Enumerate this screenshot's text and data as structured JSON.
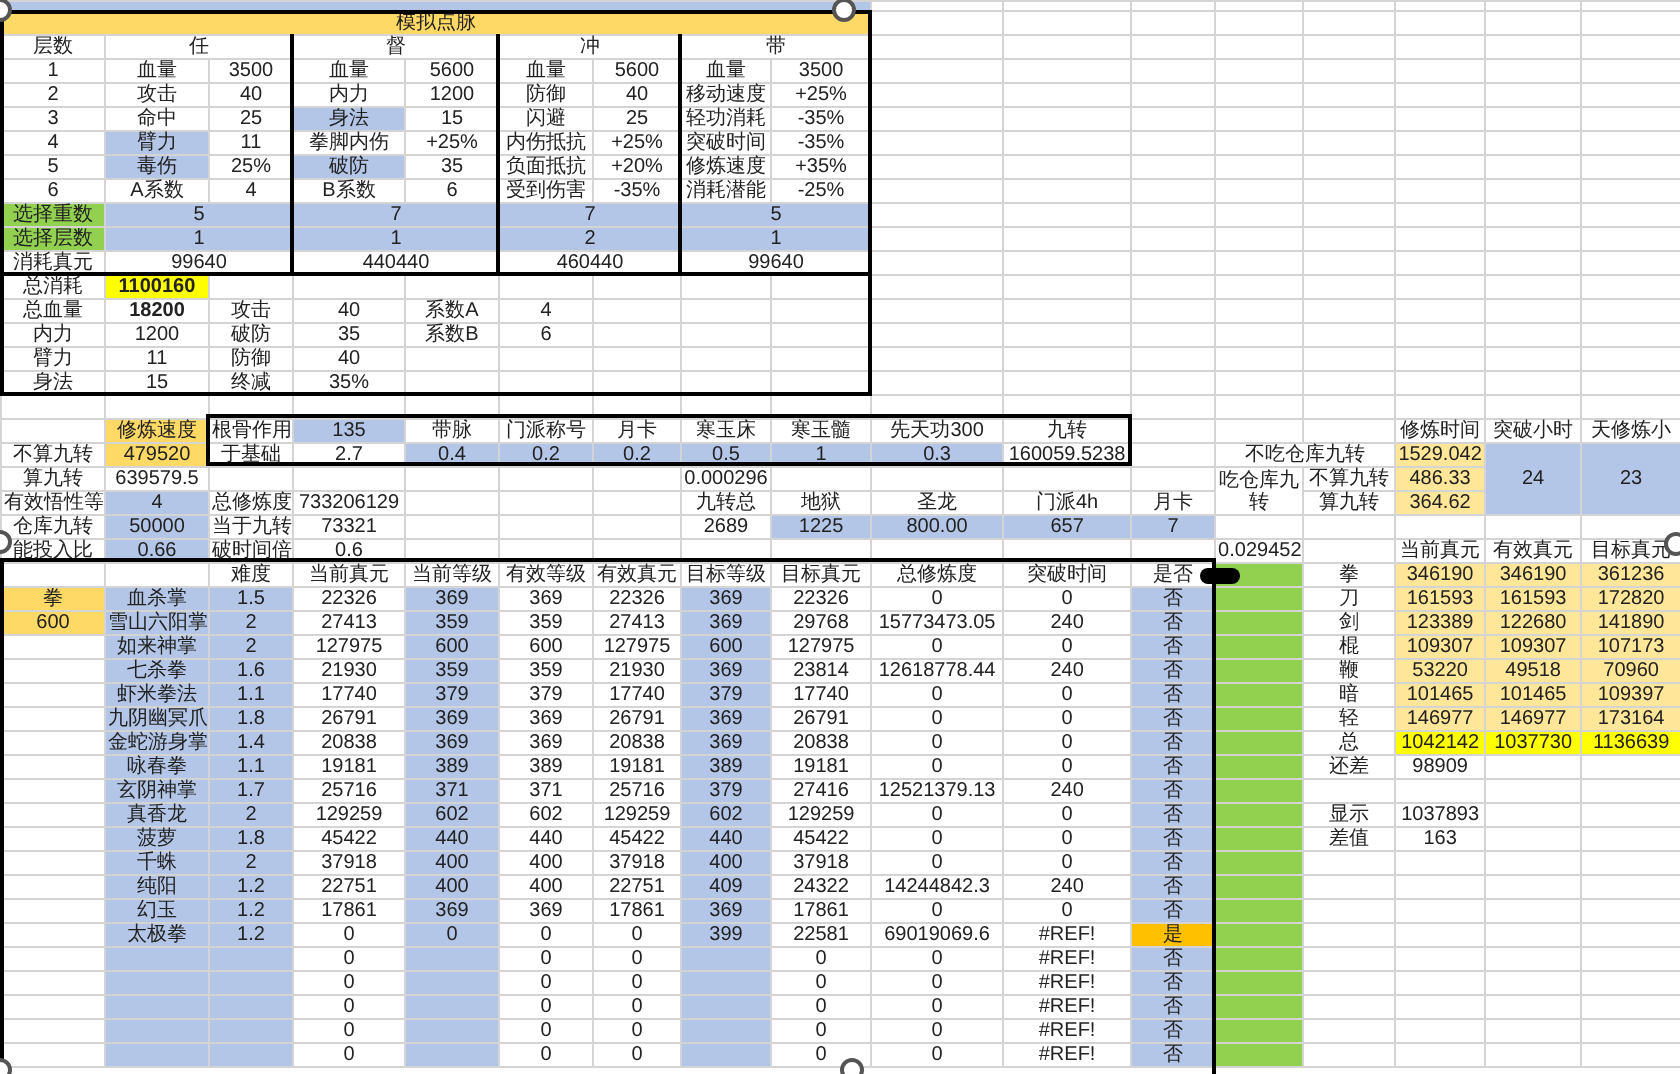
{
  "sheet": {
    "rows": [
      [
        {
          "color": "#b4c6e7",
          "colspan": 9
        }
      ],
      [
        {
          "text": "模拟点脉",
          "color": "#ffd966",
          "colspan": 9
        }
      ],
      [
        "层数",
        {
          "text": "任",
          "colspan": 2
        },
        {
          "text": "督",
          "colspan": 2
        },
        {
          "text": "冲",
          "colspan": 2
        },
        {
          "text": "带",
          "colspan": 2
        }
      ],
      [
        "1",
        "血量",
        "3500",
        "血量",
        "5600",
        "血量",
        "5600",
        "血量",
        "3500"
      ],
      [
        "2",
        "攻击",
        "40",
        "内力",
        "1200",
        "防御",
        "40",
        "移动速度",
        "+25%"
      ],
      [
        "3",
        "命中",
        "25",
        {
          "text": "身法",
          "color": "#b4c6e7"
        },
        "15",
        "闪避",
        "25",
        "轻功消耗",
        "-35%"
      ],
      [
        "4",
        {
          "text": "臂力",
          "color": "#b4c6e7"
        },
        "11",
        "拳脚内伤",
        "+25%",
        "内伤抵抗",
        "+25%",
        "突破时间",
        "-35%"
      ],
      [
        "5",
        {
          "text": "毒伤",
          "color": "#b4c6e7"
        },
        "25%",
        {
          "text": "破防",
          "color": "#b4c6e7"
        },
        "35",
        "负面抵抗",
        "+20%",
        "修炼速度",
        "+35%"
      ],
      [
        "6",
        "A系数",
        "4",
        "B系数",
        "6",
        "受到伤害",
        "-35%",
        "消耗潜能",
        "-25%"
      ],
      [
        {
          "text": "选择重数",
          "color": "#92d050"
        },
        {
          "text": "5",
          "color": "#b4c6e7",
          "colspan": 2
        },
        {
          "text": "7",
          "color": "#b4c6e7",
          "colspan": 2
        },
        {
          "text": "7",
          "color": "#b4c6e7",
          "colspan": 2
        },
        {
          "text": "5",
          "color": "#b4c6e7",
          "colspan": 2
        }
      ],
      [
        {
          "text": "选择层数",
          "color": "#92d050"
        },
        {
          "text": "1",
          "color": "#b4c6e7",
          "colspan": 2
        },
        {
          "text": "1",
          "color": "#b4c6e7",
          "colspan": 2
        },
        {
          "text": "2",
          "color": "#b4c6e7",
          "colspan": 2
        },
        {
          "text": "1",
          "color": "#b4c6e7",
          "colspan": 2
        }
      ],
      [
        "消耗真元",
        {
          "text": "99640",
          "colspan": 2
        },
        {
          "text": "440440",
          "colspan": 2
        },
        {
          "text": "460440",
          "colspan": 2
        },
        {
          "text": "99640",
          "colspan": 2
        }
      ],
      [
        "总消耗",
        {
          "text": "1100160",
          "color": "#ffff00",
          "bold": true
        }
      ],
      [
        "总血量",
        {
          "text": "18200",
          "bold": true
        },
        "攻击",
        "40",
        "系数A",
        "4"
      ],
      [
        "内力",
        "1200",
        "破防",
        "35",
        "系数B",
        "6"
      ],
      [
        "臂力",
        "11",
        "防御",
        "40"
      ],
      [
        "身法",
        "15",
        "终减",
        "35%"
      ],
      [],
      [
        null,
        {
          "text": "修炼速度",
          "color": "#ffd966"
        },
        "根骨作用",
        {
          "text": "135",
          "color": "#b4c6e7"
        },
        "带脉",
        "门派称号",
        "月卡",
        "寒玉床",
        "寒玉髓",
        "先天功300",
        "九转",
        null,
        null,
        null,
        "修炼时间",
        "突破小时",
        "天修炼小"
      ],
      [
        "不算九转",
        {
          "text": "479520",
          "color": "#ffd966"
        },
        "于基础",
        "2.7",
        {
          "text": "0.4",
          "color": "#b4c6e7"
        },
        {
          "text": "0.2",
          "color": "#b4c6e7"
        },
        {
          "text": "0.2",
          "color": "#b4c6e7"
        },
        {
          "text": "0.5",
          "color": "#b4c6e7"
        },
        {
          "text": "1",
          "color": "#b4c6e7"
        },
        {
          "text": "0.3",
          "color": "#b4c6e7"
        },
        "160059.5238",
        null,
        {
          "text": "不吃仓库九转",
          "colspan": 2
        },
        {
          "text": "1529.042",
          "color": "#ffe699"
        },
        {
          "text": "24",
          "color": "#b4c6e7",
          "rowspan": 3
        },
        {
          "text": "23",
          "color": "#b4c6e7",
          "rowspan": 3
        }
      ],
      [
        "算九转",
        "639579.5",
        null,
        null,
        null,
        null,
        null,
        "0.000296",
        null,
        null,
        null,
        null,
        {
          "text": "吃仓库九转",
          "rowspan": 2
        },
        "不算九转",
        {
          "text": "486.33",
          "color": "#ffe699"
        }
      ],
      [
        "有效悟性等",
        {
          "text": "4",
          "color": "#b4c6e7"
        },
        "总修炼度",
        "733206129",
        null,
        null,
        null,
        "九转总",
        "地狱",
        "圣龙",
        "门派4h",
        "月卡",
        "算九转",
        {
          "text": "364.62",
          "color": "#ffe699"
        }
      ],
      [
        "仓库九转",
        {
          "text": "50000",
          "color": "#b4c6e7"
        },
        "当于九转",
        "73321",
        null,
        null,
        null,
        "2689",
        {
          "text": "1225",
          "color": "#b4c6e7"
        },
        {
          "text": "800.00",
          "color": "#b4c6e7"
        },
        {
          "text": "657",
          "color": "#b4c6e7"
        },
        {
          "text": "7",
          "color": "#b4c6e7"
        }
      ],
      [
        "能投入比",
        {
          "text": "0.66",
          "color": "#b4c6e7"
        },
        "破时间倍",
        "0.6",
        null,
        null,
        null,
        null,
        null,
        null,
        null,
        null,
        "0.029452",
        null,
        "当前真元",
        "有效真元",
        "目标真元"
      ],
      [
        null,
        null,
        "难度",
        "当前真元",
        "当前等级",
        "有效等级",
        "有效真元",
        "目标等级",
        "目标真元",
        "总修炼度",
        "突破时间",
        "是否",
        {
          "color": "#92d050"
        },
        "拳",
        {
          "text": "346190",
          "color": "#ffe699"
        },
        {
          "text": "346190",
          "color": "#ffe699"
        },
        {
          "text": "361236",
          "color": "#ffe699"
        }
      ],
      [
        {
          "text": "拳",
          "color": "#ffd966"
        },
        {
          "text": "血杀掌",
          "color": "#b4c6e7"
        },
        {
          "text": "1.5",
          "color": "#b4c6e7"
        },
        "22326",
        {
          "text": "369",
          "color": "#b4c6e7"
        },
        "369",
        "22326",
        {
          "text": "369",
          "color": "#b4c6e7"
        },
        "22326",
        "0",
        "0",
        {
          "text": "否",
          "color": "#b4c6e7"
        },
        {
          "color": "#92d050"
        },
        "刀",
        {
          "text": "161593",
          "color": "#ffe699"
        },
        {
          "text": "161593",
          "color": "#ffe699"
        },
        {
          "text": "172820",
          "color": "#ffe699"
        }
      ],
      [
        {
          "text": "600",
          "color": "#ffd966"
        },
        {
          "text": "雪山六阳掌",
          "color": "#b4c6e7"
        },
        {
          "text": "2",
          "color": "#b4c6e7"
        },
        "27413",
        {
          "text": "359",
          "color": "#b4c6e7"
        },
        "359",
        "27413",
        {
          "text": "369",
          "color": "#b4c6e7"
        },
        "29768",
        "15773473.05",
        "240",
        {
          "text": "否",
          "color": "#b4c6e7"
        },
        {
          "color": "#92d050"
        },
        "剑",
        {
          "text": "123389",
          "color": "#ffe699"
        },
        {
          "text": "122680",
          "color": "#ffe699"
        },
        {
          "text": "141890",
          "color": "#ffe699"
        }
      ],
      [
        null,
        {
          "text": "如来神掌",
          "color": "#b4c6e7"
        },
        {
          "text": "2",
          "color": "#b4c6e7"
        },
        "127975",
        {
          "text": "600",
          "color": "#b4c6e7"
        },
        "600",
        "127975",
        {
          "text": "600",
          "color": "#b4c6e7"
        },
        "127975",
        "0",
        "0",
        {
          "text": "否",
          "color": "#b4c6e7"
        },
        {
          "color": "#92d050"
        },
        "棍",
        {
          "text": "109307",
          "color": "#ffe699"
        },
        {
          "text": "109307",
          "color": "#ffe699"
        },
        {
          "text": "107173",
          "color": "#ffe699"
        }
      ],
      [
        null,
        {
          "text": "七杀拳",
          "color": "#b4c6e7"
        },
        {
          "text": "1.6",
          "color": "#b4c6e7"
        },
        "21930",
        {
          "text": "359",
          "color": "#b4c6e7"
        },
        "359",
        "21930",
        {
          "text": "369",
          "color": "#b4c6e7"
        },
        "23814",
        "12618778.44",
        "240",
        {
          "text": "否",
          "color": "#b4c6e7"
        },
        {
          "color": "#92d050"
        },
        "鞭",
        {
          "text": "53220",
          "color": "#ffe699"
        },
        {
          "text": "49518",
          "color": "#ffe699"
        },
        {
          "text": "70960",
          "color": "#ffe699"
        }
      ],
      [
        null,
        {
          "text": "虾米拳法",
          "color": "#b4c6e7"
        },
        {
          "text": "1.1",
          "color": "#b4c6e7"
        },
        "17740",
        {
          "text": "379",
          "color": "#b4c6e7"
        },
        "379",
        "17740",
        {
          "text": "379",
          "color": "#b4c6e7"
        },
        "17740",
        "0",
        "0",
        {
          "text": "否",
          "color": "#b4c6e7"
        },
        {
          "color": "#92d050"
        },
        "暗",
        {
          "text": "101465",
          "color": "#ffe699"
        },
        {
          "text": "101465",
          "color": "#ffe699"
        },
        {
          "text": "109397",
          "color": "#ffe699"
        }
      ],
      [
        null,
        {
          "text": "九阴幽冥爪",
          "color": "#b4c6e7"
        },
        {
          "text": "1.8",
          "color": "#b4c6e7"
        },
        "26791",
        {
          "text": "369",
          "color": "#b4c6e7"
        },
        "369",
        "26791",
        {
          "text": "369",
          "color": "#b4c6e7"
        },
        "26791",
        "0",
        "0",
        {
          "text": "否",
          "color": "#b4c6e7"
        },
        {
          "color": "#92d050"
        },
        "轻",
        {
          "text": "146977",
          "color": "#ffe699"
        },
        {
          "text": "146977",
          "color": "#ffe699"
        },
        {
          "text": "173164",
          "color": "#ffe699"
        }
      ],
      [
        null,
        {
          "text": "金蛇游身掌",
          "color": "#b4c6e7"
        },
        {
          "text": "1.4",
          "color": "#b4c6e7"
        },
        "20838",
        {
          "text": "369",
          "color": "#b4c6e7"
        },
        "369",
        "20838",
        {
          "text": "369",
          "color": "#b4c6e7"
        },
        "20838",
        "0",
        "0",
        {
          "text": "否",
          "color": "#b4c6e7"
        },
        {
          "color": "#92d050"
        },
        "总",
        {
          "text": "1042142",
          "color": "#ffff00"
        },
        {
          "text": "1037730",
          "color": "#ffff00"
        },
        {
          "text": "1136639",
          "color": "#ffff00"
        }
      ],
      [
        null,
        {
          "text": "咏春拳",
          "color": "#b4c6e7"
        },
        {
          "text": "1.1",
          "color": "#b4c6e7"
        },
        "19181",
        {
          "text": "389",
          "color": "#b4c6e7"
        },
        "389",
        "19181",
        {
          "text": "389",
          "color": "#b4c6e7"
        },
        "19181",
        "0",
        "0",
        {
          "text": "否",
          "color": "#b4c6e7"
        },
        {
          "color": "#92d050"
        },
        "还差",
        "98909"
      ],
      [
        null,
        {
          "text": "玄阴神掌",
          "color": "#b4c6e7"
        },
        {
          "text": "1.7",
          "color": "#b4c6e7"
        },
        "25716",
        {
          "text": "371",
          "color": "#b4c6e7"
        },
        "371",
        "25716",
        {
          "text": "379",
          "color": "#b4c6e7"
        },
        "27416",
        "12521379.13",
        "240",
        {
          "text": "否",
          "color": "#b4c6e7"
        },
        {
          "color": "#92d050"
        }
      ],
      [
        null,
        {
          "text": "真香龙",
          "color": "#b4c6e7"
        },
        {
          "text": "2",
          "color": "#b4c6e7"
        },
        "129259",
        {
          "text": "602",
          "color": "#b4c6e7"
        },
        "602",
        "129259",
        {
          "text": "602",
          "color": "#b4c6e7"
        },
        "129259",
        "0",
        "0",
        {
          "text": "否",
          "color": "#b4c6e7"
        },
        {
          "color": "#92d050"
        },
        "显示",
        "1037893"
      ],
      [
        null,
        {
          "text": "菠萝",
          "color": "#b4c6e7"
        },
        {
          "text": "1.8",
          "color": "#b4c6e7"
        },
        "45422",
        {
          "text": "440",
          "color": "#b4c6e7"
        },
        "440",
        "45422",
        {
          "text": "440",
          "color": "#b4c6e7"
        },
        "45422",
        "0",
        "0",
        {
          "text": "否",
          "color": "#b4c6e7"
        },
        {
          "color": "#92d050"
        },
        "差值",
        "163"
      ],
      [
        null,
        {
          "text": "千蛛",
          "color": "#b4c6e7"
        },
        {
          "text": "2",
          "color": "#b4c6e7"
        },
        "37918",
        {
          "text": "400",
          "color": "#b4c6e7"
        },
        "400",
        "37918",
        {
          "text": "400",
          "color": "#b4c6e7"
        },
        "37918",
        "0",
        "0",
        {
          "text": "否",
          "color": "#b4c6e7"
        },
        {
          "color": "#92d050"
        }
      ],
      [
        null,
        {
          "text": "纯阳",
          "color": "#b4c6e7"
        },
        {
          "text": "1.2",
          "color": "#b4c6e7"
        },
        "22751",
        {
          "text": "400",
          "color": "#b4c6e7"
        },
        "400",
        "22751",
        {
          "text": "409",
          "color": "#b4c6e7"
        },
        "24322",
        "14244842.3",
        "240",
        {
          "text": "否",
          "color": "#b4c6e7"
        },
        {
          "color": "#92d050"
        }
      ],
      [
        null,
        {
          "text": "幻玉",
          "color": "#b4c6e7"
        },
        {
          "text": "1.2",
          "color": "#b4c6e7"
        },
        "17861",
        {
          "text": "369",
          "color": "#b4c6e7"
        },
        "369",
        "17861",
        {
          "text": "369",
          "color": "#b4c6e7"
        },
        "17861",
        "0",
        "0",
        {
          "text": "否",
          "color": "#b4c6e7"
        },
        {
          "color": "#92d050"
        }
      ],
      [
        null,
        {
          "text": "太极拳",
          "color": "#b4c6e7"
        },
        {
          "text": "1.2",
          "color": "#b4c6e7"
        },
        "0",
        {
          "text": "0",
          "color": "#b4c6e7"
        },
        "0",
        "0",
        {
          "text": "399",
          "color": "#b4c6e7"
        },
        "22581",
        "69019069.6",
        "#REF!",
        {
          "text": "是",
          "color": "#ffc000"
        },
        {
          "color": "#92d050"
        }
      ],
      [
        null,
        {
          "color": "#b4c6e7"
        },
        {
          "color": "#b4c6e7"
        },
        "0",
        {
          "color": "#b4c6e7"
        },
        "0",
        "0",
        {
          "color": "#b4c6e7"
        },
        "0",
        "0",
        "#REF!",
        {
          "text": "否",
          "color": "#b4c6e7"
        },
        {
          "color": "#92d050"
        }
      ],
      [
        null,
        {
          "color": "#b4c6e7"
        },
        {
          "color": "#b4c6e7"
        },
        "0",
        {
          "color": "#b4c6e7"
        },
        "0",
        "0",
        {
          "color": "#b4c6e7"
        },
        "0",
        "0",
        "#REF!",
        {
          "text": "否",
          "color": "#b4c6e7"
        },
        {
          "color": "#92d050"
        }
      ],
      [
        null,
        {
          "color": "#b4c6e7"
        },
        {
          "color": "#b4c6e7"
        },
        "0",
        {
          "color": "#b4c6e7"
        },
        "0",
        "0",
        {
          "color": "#b4c6e7"
        },
        "0",
        "0",
        "#REF!",
        {
          "text": "否",
          "color": "#b4c6e7"
        },
        {
          "color": "#92d050"
        }
      ],
      [
        null,
        {
          "color": "#b4c6e7"
        },
        {
          "color": "#b4c6e7"
        },
        "0",
        {
          "color": "#b4c6e7"
        },
        "0",
        "0",
        {
          "color": "#b4c6e7"
        },
        "0",
        "0",
        "#REF!",
        {
          "text": "否",
          "color": "#b4c6e7"
        },
        {
          "color": "#92d050"
        }
      ],
      [
        null,
        {
          "color": "#b4c6e7"
        },
        {
          "color": "#b4c6e7"
        },
        "0",
        {
          "color": "#b4c6e7"
        },
        "0",
        "0",
        {
          "color": "#b4c6e7"
        },
        "0",
        "0",
        "#REF!",
        {
          "text": "否",
          "color": "#b4c6e7"
        },
        {
          "color": "#92d050"
        }
      ]
    ]
  }
}
